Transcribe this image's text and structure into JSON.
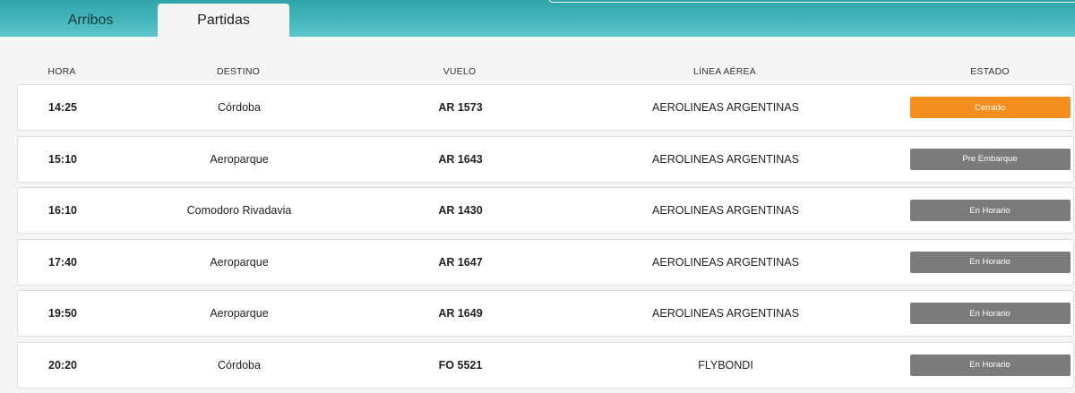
{
  "tabs": [
    {
      "label": "Arribos"
    },
    {
      "label": "Partidas"
    }
  ],
  "table": {
    "headers": {
      "hora": "HORA",
      "destino": "DESTINO",
      "vuelo": "VUELO",
      "linea": "LÍNEA AÉREA",
      "estado": "ESTADO"
    },
    "rows": [
      {
        "hora": "14:25",
        "destino": "Córdoba",
        "vuelo": "AR 1573",
        "linea": "AEROLINEAS ARGENTINAS",
        "estado": "Cerrado",
        "estado_color": "#f48f1f"
      },
      {
        "hora": "15:10",
        "destino": "Aeroparque",
        "vuelo": "AR 1643",
        "linea": "AEROLINEAS ARGENTINAS",
        "estado": "Pre Embarque",
        "estado_color": "#7b7b7b"
      },
      {
        "hora": "16:10",
        "destino": "Comodoro Rivadavia",
        "vuelo": "AR 1430",
        "linea": "AEROLINEAS ARGENTINAS",
        "estado": "En Horario",
        "estado_color": "#7b7b7b"
      },
      {
        "hora": "17:40",
        "destino": "Aeroparque",
        "vuelo": "AR 1647",
        "linea": "AEROLINEAS ARGENTINAS",
        "estado": "En Horario",
        "estado_color": "#7b7b7b"
      },
      {
        "hora": "19:50",
        "destino": "Aeroparque",
        "vuelo": "AR 1649",
        "linea": "AEROLINEAS ARGENTINAS",
        "estado": "En Horario",
        "estado_color": "#7b7b7b"
      },
      {
        "hora": "20:20",
        "destino": "Córdoba",
        "vuelo": "FO 5521",
        "linea": "FLYBONDI",
        "estado": "En Horario",
        "estado_color": "#7b7b7b"
      }
    ]
  },
  "colors": {
    "header_bar": "#46b8bd",
    "status_closed": "#f48f1f",
    "status_default": "#7b7b7b"
  }
}
